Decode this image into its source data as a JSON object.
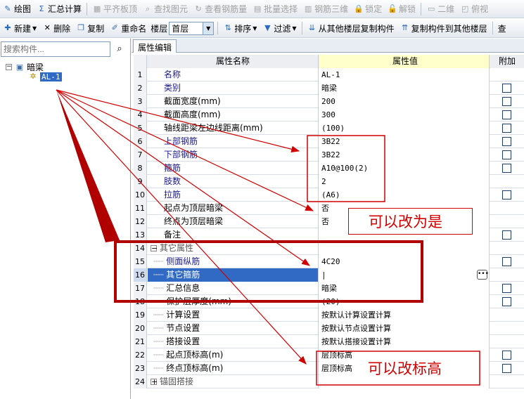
{
  "toolbar1": {
    "items": [
      {
        "name": "draw-button",
        "icon": "✎",
        "label": "绘图",
        "enabled": true
      },
      {
        "name": "summary-calc-button",
        "icon": "Σ",
        "label": "汇总计算",
        "enabled": true
      },
      {
        "name": "flush-slab-top-button",
        "icon": "▦",
        "label": "平齐板顶",
        "enabled": false
      },
      {
        "name": "find-element-button",
        "icon": "⌕",
        "label": "查找图元",
        "enabled": false
      },
      {
        "name": "view-rebar-qty-button",
        "icon": "↻",
        "label": "查看钢筋量",
        "enabled": false
      },
      {
        "name": "batch-select-button",
        "icon": "▤",
        "label": "批量选择",
        "enabled": false
      },
      {
        "name": "rebar-3d-button",
        "icon": "▥",
        "label": "钢筋三维",
        "enabled": false
      },
      {
        "name": "lock-button",
        "icon": "🔒",
        "label": "锁定",
        "enabled": false
      },
      {
        "name": "unlock-button",
        "icon": "🔓",
        "label": "解锁",
        "enabled": false
      },
      {
        "name": "2d-view-button",
        "icon": "▭",
        "label": "二维",
        "enabled": false
      },
      {
        "name": "top-view-button",
        "icon": "◰",
        "label": "俯视",
        "enabled": false
      }
    ]
  },
  "toolbar2": {
    "new_label": "新建",
    "delete_label": "删除",
    "copy_label": "复制",
    "rename_label": "重命名",
    "floor_label": "楼层",
    "floor_value": "首层",
    "sort_label": "排序",
    "filter_label": "过滤",
    "copy_from_floor_label": "从其他楼层复制构件",
    "copy_to_floor_label": "复制构件到其他楼层",
    "more_label": "查"
  },
  "left": {
    "search_placeholder": "搜索构件...",
    "tree_root": "暗梁",
    "tree_child": "AL-1"
  },
  "tab": "属性编辑",
  "grid": {
    "header": {
      "name": "属性名称",
      "value": "属性值",
      "extra": "附加"
    },
    "rows": [
      {
        "no": "1",
        "name": "名称",
        "value": "AL-1",
        "blue": true,
        "check": false
      },
      {
        "no": "2",
        "name": "类别",
        "value": "暗梁",
        "blue": true,
        "check": true
      },
      {
        "no": "3",
        "name": "截面宽度(mm)",
        "value": "200",
        "blue": false,
        "check": true
      },
      {
        "no": "4",
        "name": "截面高度(mm)",
        "value": "300",
        "blue": false,
        "check": true
      },
      {
        "no": "5",
        "name": "轴线距梁左边线距离(mm)",
        "value": "(100)",
        "blue": false,
        "check": true
      },
      {
        "no": "6",
        "name": "上部钢筋",
        "value": "3B22",
        "blue": true,
        "check": true
      },
      {
        "no": "7",
        "name": "下部钢筋",
        "value": "3B22",
        "blue": true,
        "check": true
      },
      {
        "no": "8",
        "name": "箍筋",
        "value": "A10@100(2)",
        "blue": true,
        "check": true
      },
      {
        "no": "9",
        "name": "肢数",
        "value": "2",
        "blue": true,
        "check": false
      },
      {
        "no": "10",
        "name": "拉筋",
        "value": "(A6)",
        "blue": true,
        "check": true
      },
      {
        "no": "11",
        "name": "起点为顶层暗梁",
        "value": "否",
        "blue": false,
        "check": false
      },
      {
        "no": "12",
        "name": "终点为顶层暗梁",
        "value": "否",
        "blue": false,
        "check": false
      },
      {
        "no": "13",
        "name": "备注",
        "value": "",
        "blue": false,
        "check": true
      },
      {
        "no": "14",
        "name": "其它属性",
        "value": "",
        "group": "−",
        "gray": true,
        "check": false
      },
      {
        "no": "15",
        "name": "侧面纵筋",
        "value": "4C20",
        "blue": true,
        "tree": true,
        "check": true
      },
      {
        "no": "16",
        "name": "其它箍筋",
        "value": "|",
        "tree": true,
        "selected": true,
        "check": false
      },
      {
        "no": "17",
        "name": "汇总信息",
        "value": "暗梁",
        "tree": true,
        "check": true
      },
      {
        "no": "18",
        "name": "保护层厚度(mm)",
        "value": "(20)",
        "tree": true,
        "check": true
      },
      {
        "no": "19",
        "name": "计算设置",
        "value": "按默认计算设置计算",
        "tree": true,
        "check": false
      },
      {
        "no": "20",
        "name": "节点设置",
        "value": "按默认节点设置计算",
        "tree": true,
        "check": false
      },
      {
        "no": "21",
        "name": "搭接设置",
        "value": "按默认搭接设置计算",
        "tree": true,
        "check": false
      },
      {
        "no": "22",
        "name": "起点顶标高(m)",
        "value": "层顶标高",
        "tree": true,
        "check": true
      },
      {
        "no": "23",
        "name": "终点顶标高(m)",
        "value": "层顶标高",
        "tree": true,
        "check": true
      },
      {
        "no": "24",
        "name": "锚固搭接",
        "value": "",
        "group": "+",
        "gray": true,
        "check": false
      }
    ]
  },
  "annotations": {
    "note1": "可以改为是",
    "note2": "可以改标高",
    "color": "#d00000"
  }
}
